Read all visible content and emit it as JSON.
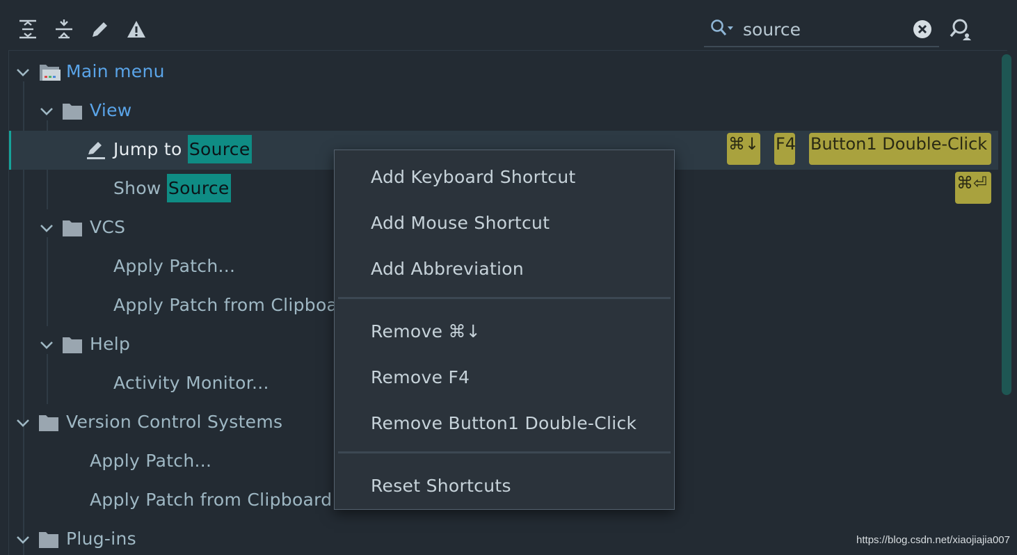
{
  "toolbar": {
    "icons": [
      "expand-all-icon",
      "collapse-all-icon",
      "edit-icon",
      "warning-icon"
    ],
    "search_value": "source",
    "search_icon": "search-history-icon",
    "clear_icon": "clear-icon",
    "find_shortcut_icon": "find-by-shortcut-icon"
  },
  "tree": {
    "main_menu": "Main menu",
    "view": "View",
    "jump_prefix": "Jump to ",
    "jump_match": "Source",
    "show_prefix": "Show ",
    "show_match": "Source",
    "vcs": "VCS",
    "apply_patch": "Apply Patch...",
    "apply_patch_clip": "Apply Patch from Clipboard...",
    "help": "Help",
    "activity_monitor": "Activity Monitor...",
    "version_control": "Version Control Systems",
    "vc_apply_patch": "Apply Patch...",
    "vc_apply_patch_clip": "Apply Patch from Clipboard...",
    "plugins": "Plug-ins"
  },
  "shortcuts": {
    "jump": [
      "⌘↓",
      "F4",
      "Button1 Double-Click"
    ],
    "show": [
      "⌘⏎"
    ]
  },
  "context_menu": {
    "items": [
      "Add Keyboard Shortcut",
      "Add Mouse Shortcut",
      "Add Abbreviation",
      "Remove ⌘↓",
      "Remove F4",
      "Remove Button1 Double-Click",
      "Reset Shortcuts"
    ]
  },
  "watermark": "https://blog.csdn.net/xiaojiajia007",
  "colors": {
    "background": "#232b33",
    "group_label": "#5aa4e8",
    "match_highlight": "#0f8c84",
    "shortcut_badge": "#a9a23e",
    "selection_marker": "#16a39a"
  }
}
